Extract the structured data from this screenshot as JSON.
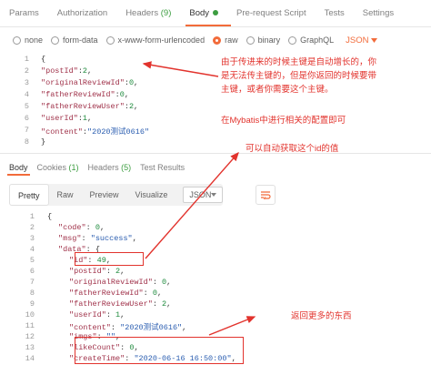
{
  "tabs": {
    "params": "Params",
    "authorization": "Authorization",
    "headers": "Headers",
    "headers_count": "(9)",
    "body": "Body",
    "prerequest": "Pre-request Script",
    "tests": "Tests",
    "settings": "Settings"
  },
  "body_types": {
    "none": "none",
    "form_data": "form-data",
    "urlencoded": "x-www-form-urlencoded",
    "raw": "raw",
    "binary": "binary",
    "graphql": "GraphQL",
    "format": "JSON",
    "format_icon": "chevron-down-icon"
  },
  "request_lines": [
    {
      "n": "1",
      "t": "{"
    },
    {
      "n": "2",
      "t": "\"postId\":2,"
    },
    {
      "n": "3",
      "t": "\"originalReviewId\":0,"
    },
    {
      "n": "4",
      "t": "\"fatherReviewId\":0,"
    },
    {
      "n": "5",
      "t": "\"fatherReviewUser\":2,"
    },
    {
      "n": "6",
      "t": "\"userId\":1,"
    },
    {
      "n": "7",
      "t": "\"content\":\"2020测试0616\""
    },
    {
      "n": "8",
      "t": "}"
    }
  ],
  "response_tabs": {
    "body": "Body",
    "cookies": "Cookies",
    "cookies_count": "(1)",
    "headers": "Headers",
    "headers_count": "(5)",
    "test_results": "Test Results"
  },
  "response_toolbar": {
    "pretty": "Pretty",
    "raw": "Raw",
    "preview": "Preview",
    "visualize": "Visualize",
    "format": "JSON"
  },
  "response_lines": [
    {
      "n": "1",
      "t": "{"
    },
    {
      "n": "2",
      "t": "\"code\": 0,"
    },
    {
      "n": "3",
      "t": "\"msg\": \"success\","
    },
    {
      "n": "4",
      "t": "\"data\": {"
    },
    {
      "n": "5",
      "t": "\"id\": 49,"
    },
    {
      "n": "6",
      "t": "\"postId\": 2,"
    },
    {
      "n": "7",
      "t": "\"originalReviewId\": 0,"
    },
    {
      "n": "8",
      "t": "\"fatherReviewId\": 0,"
    },
    {
      "n": "9",
      "t": "\"fatherReviewUser\": 2,"
    },
    {
      "n": "10",
      "t": "\"userId\": 1,"
    },
    {
      "n": "11",
      "t": "\"content\": \"2020测试0616\","
    },
    {
      "n": "12",
      "t": "\"imgs\": \"\","
    },
    {
      "n": "13",
      "t": "\"likeCount\": 0,"
    },
    {
      "n": "14",
      "t": "\"createTime\": \"2020-06-16 16:50:00\","
    }
  ],
  "annotations": {
    "note1_line1": "由于传进来的时候主键是自动增长的，你",
    "note1_line2": "是无法传主键的，但是你返回的时候要带",
    "note1_line3": "主键，或者你需要这个主键。",
    "note2": "在Mybatis中进行相关的配置即可",
    "note3": "可以自动获取这个id的值",
    "note4": "返回更多的东西"
  },
  "colors": {
    "accent": "#f26b3a",
    "count_green": "#3c9d40",
    "annotation_red": "#e2332d"
  }
}
